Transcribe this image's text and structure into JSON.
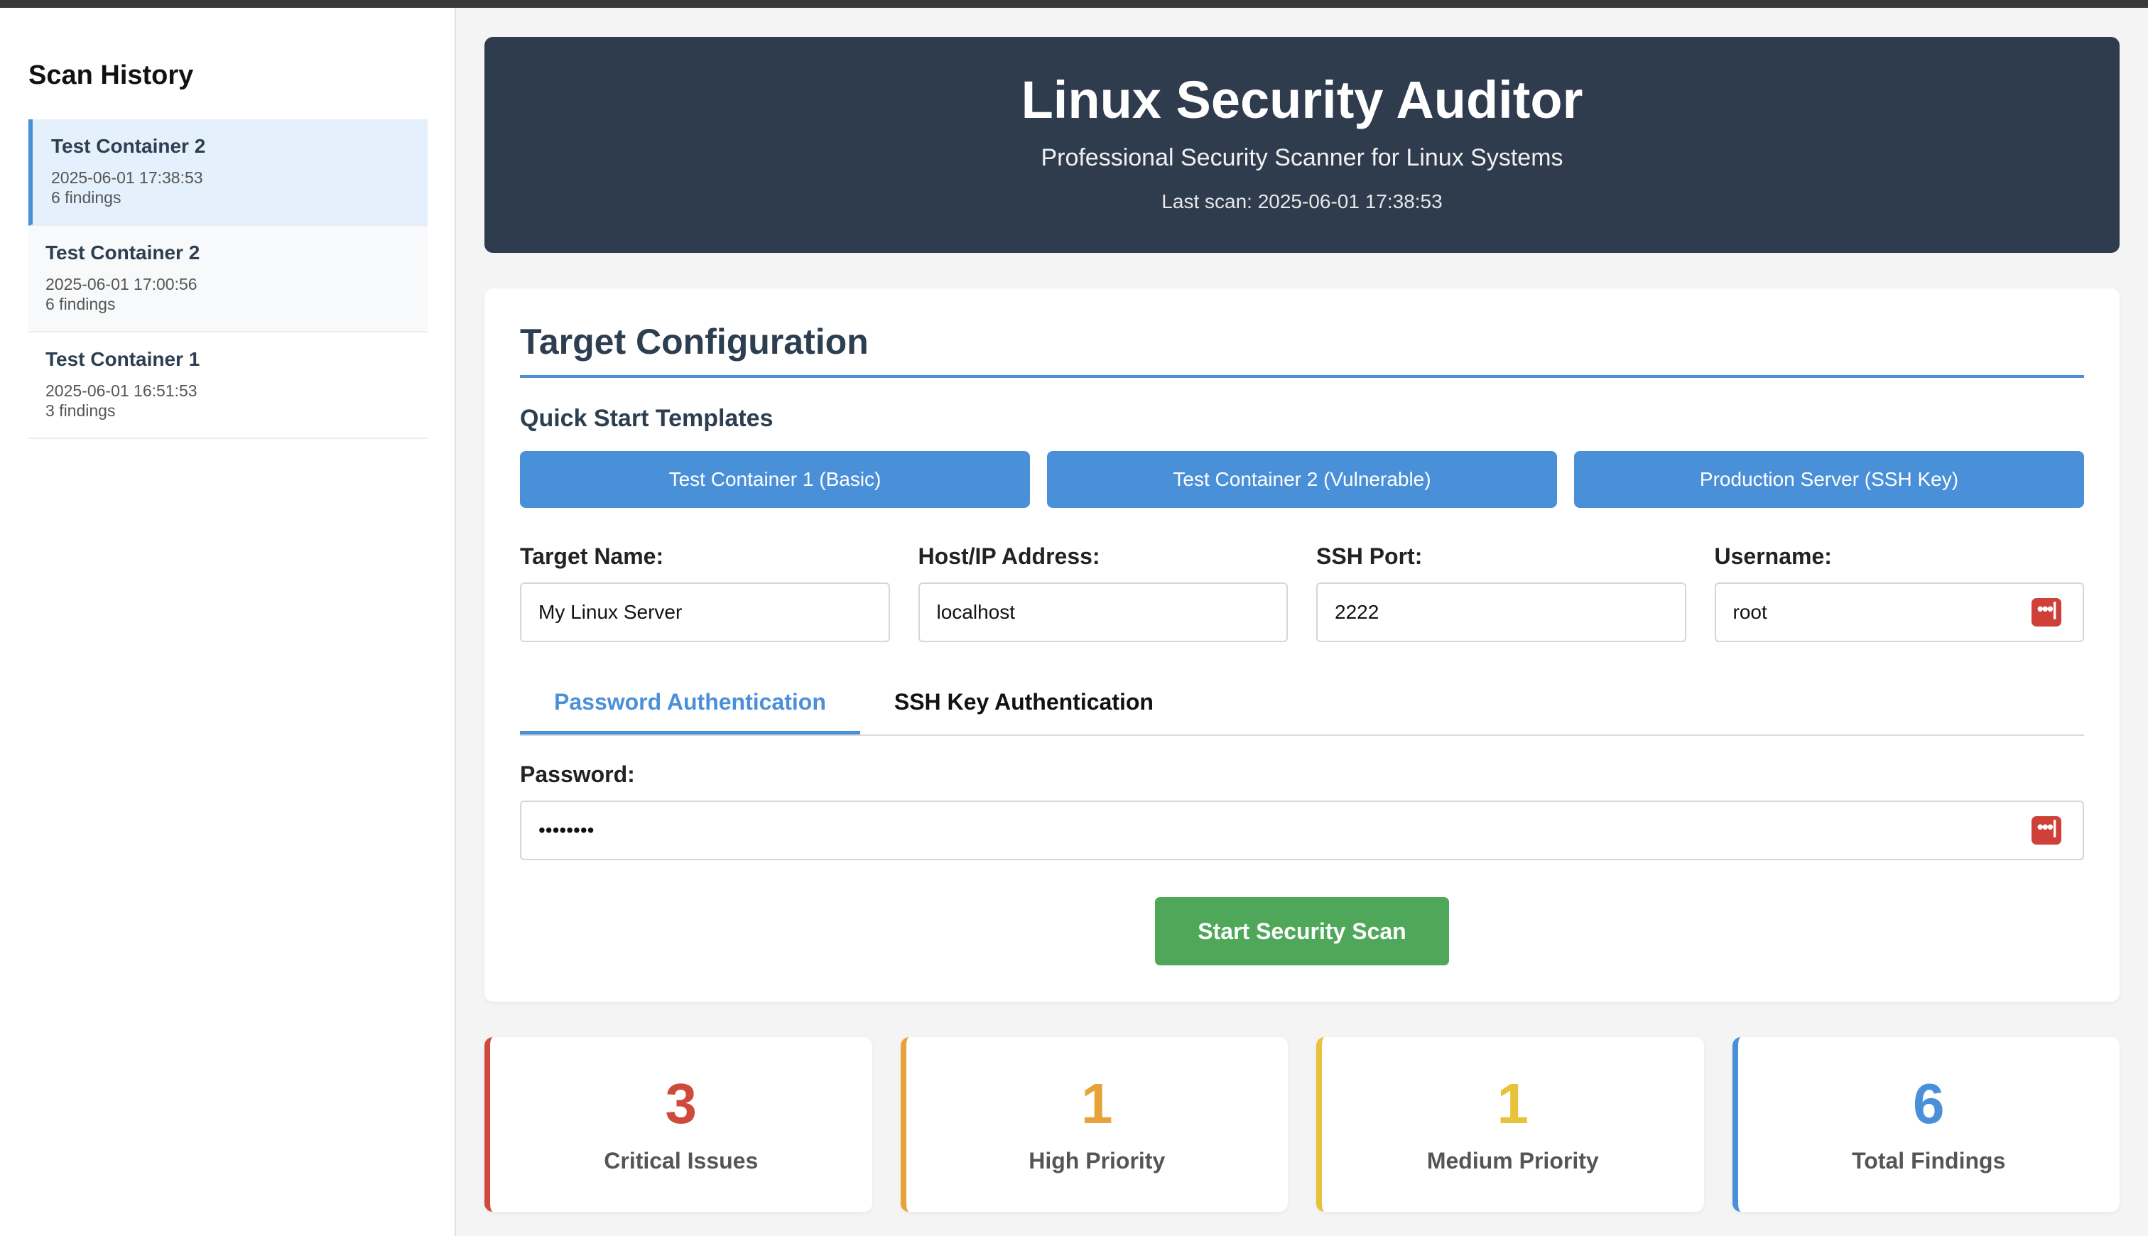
{
  "sidebar": {
    "title": "Scan History",
    "items": [
      {
        "name": "Test Container 2",
        "timestamp": "2025-06-01 17:38:53",
        "findings": "6 findings"
      },
      {
        "name": "Test Container 2",
        "timestamp": "2025-06-01 17:00:56",
        "findings": "6 findings"
      },
      {
        "name": "Test Container 1",
        "timestamp": "2025-06-01 16:51:53",
        "findings": "3 findings"
      }
    ]
  },
  "header": {
    "title": "Linux Security Auditor",
    "subtitle": "Professional Security Scanner for Linux Systems",
    "last_scan": "Last scan: 2025-06-01 17:38:53"
  },
  "config": {
    "title": "Target Configuration",
    "templates_title": "Quick Start Templates",
    "templates": [
      "Test Container 1 (Basic)",
      "Test Container 2 (Vulnerable)",
      "Production Server (SSH Key)"
    ],
    "fields": {
      "target_name": {
        "label": "Target Name:",
        "value": "My Linux Server"
      },
      "host": {
        "label": "Host/IP Address:",
        "value": "localhost"
      },
      "port": {
        "label": "SSH Port:",
        "value": "2222"
      },
      "username": {
        "label": "Username:",
        "value": "root"
      }
    },
    "tabs": [
      "Password Authentication",
      "SSH Key Authentication"
    ],
    "password": {
      "label": "Password:",
      "value": "••••••••"
    },
    "scan_button": "Start Security Scan",
    "password_manager_icon": "•••|"
  },
  "stats": [
    {
      "value": "3",
      "label": "Critical Issues",
      "color": "#d04a3c"
    },
    {
      "value": "1",
      "label": "High Priority",
      "color": "#e8a23a"
    },
    {
      "value": "1",
      "label": "Medium Priority",
      "color": "#e8c23a"
    },
    {
      "value": "6",
      "label": "Total Findings",
      "color": "#4a90d9"
    }
  ],
  "colors": {
    "accent": "#4a90d9",
    "hero_bg": "#2f3c4e",
    "scan_button": "#4fa85a",
    "password_icon": "#cf4038"
  }
}
